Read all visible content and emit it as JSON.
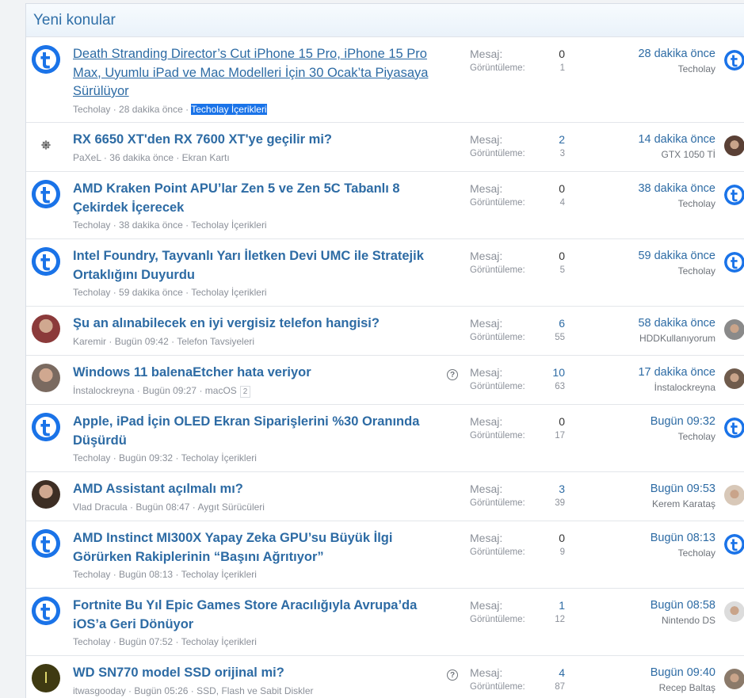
{
  "header": {
    "title": "Yeni konular"
  },
  "labels": {
    "messages": "Mesaj:",
    "views": "Görüntüleme:"
  },
  "threads": [
    {
      "title": "Death Stranding Director’s Cut iPhone 15 Pro, iPhone 15 Pro Max, Uyumlu iPad ve Mac Modelleri İçin 30 Ocak’ta Piyasaya Sürülüyor",
      "author": "Techolay",
      "time": "28 dakika önce",
      "forum": "Techolay İçerikleri",
      "replies": "0",
      "views": "1",
      "last_time": "28 dakika önce",
      "last_user": "Techolay",
      "avatar": "techolay-icon",
      "last_avatar": "techolay-icon"
    },
    {
      "title": "RX 6650 XT'den RX 7600 XT'ye geçilir mi?",
      "author": "PaXeL",
      "time": "36 dakika önce",
      "forum": "Ekran Kartı",
      "replies": "2",
      "views": "3",
      "last_time": "14 dakika önce",
      "last_user": "GTX 1050 Tİ",
      "avatar": "sinus-avatar",
      "last_avatar": "user-avatar"
    },
    {
      "title": "AMD Kraken Point APU’lar Zen 5 ve Zen 5C Tabanlı 8 Çekirdek İçerecek",
      "author": "Techolay",
      "time": "38 dakika önce",
      "forum": "Techolay İçerikleri",
      "replies": "0",
      "views": "4",
      "last_time": "38 dakika önce",
      "last_user": "Techolay",
      "avatar": "techolay-icon",
      "last_avatar": "techolay-icon"
    },
    {
      "title": "Intel Foundry, Tayvanlı Yarı İletken Devi UMC ile Stratejik Ortaklığını Duyurdu",
      "author": "Techolay",
      "time": "59 dakika önce",
      "forum": "Techolay İçerikleri",
      "replies": "0",
      "views": "5",
      "last_time": "59 dakika önce",
      "last_user": "Techolay",
      "avatar": "techolay-icon",
      "last_avatar": "techolay-icon"
    },
    {
      "title": "Şu an alınabilecek en iyi vergisiz telefon hangisi?",
      "author": "Karemir",
      "time": "Bugün 09:42",
      "forum": "Telefon Tavsiyeleri",
      "replies": "6",
      "views": "55",
      "last_time": "58 dakika önce",
      "last_user": "HDDKullanıyorum",
      "avatar": "user-avatar",
      "last_avatar": "user-avatar"
    },
    {
      "title": "Windows 11 balenaEtcher hata veriyor",
      "author": "İnstalockreyna",
      "time": "Bugün 09:27",
      "forum": "macOS",
      "pages": "2",
      "question": "?",
      "replies": "10",
      "views": "63",
      "last_time": "17 dakika önce",
      "last_user": "İnstalockreyna",
      "avatar": "user-avatar",
      "last_avatar": "user-avatar"
    },
    {
      "title": "Apple, iPad İçin OLED Ekran Siparişlerini %30 Oranında Düşürdü",
      "author": "Techolay",
      "time": "Bugün 09:32",
      "forum": "Techolay İçerikleri",
      "replies": "0",
      "views": "17",
      "last_time": "Bugün 09:32",
      "last_user": "Techolay",
      "avatar": "techolay-icon",
      "last_avatar": "techolay-icon"
    },
    {
      "title": "AMD Assistant açılmalı mı?",
      "author": "Vlad Dracula",
      "time": "Bugün 08:47",
      "forum": "Aygıt Sürücüleri",
      "replies": "3",
      "views": "39",
      "last_time": "Bugün 09:53",
      "last_user": "Kerem Karataş",
      "avatar": "user-avatar",
      "last_avatar": "user-avatar"
    },
    {
      "title": "AMD Instinct MI300X Yapay Zeka GPU’su Büyük İlgi Görürken Rakiplerinin “Başını Ağrıtıyor”",
      "author": "Techolay",
      "time": "Bugün 08:13",
      "forum": "Techolay İçerikleri",
      "replies": "0",
      "views": "9",
      "last_time": "Bugün 08:13",
      "last_user": "Techolay",
      "avatar": "techolay-icon",
      "last_avatar": "techolay-icon"
    },
    {
      "title": "Fortnite Bu Yıl Epic Games Store Aracılığıyla Avrupa’da iOS’a Geri Dönüyor",
      "author": "Techolay",
      "time": "Bugün 07:52",
      "forum": "Techolay İçerikleri",
      "replies": "1",
      "views": "12",
      "last_time": "Bugün 08:58",
      "last_user": "Nintendo DS",
      "avatar": "techolay-icon",
      "last_avatar": "user-avatar"
    },
    {
      "title": "WD SN770 model SSD orijinal mi?",
      "author": "itwasgooday",
      "time": "Bugün 05:26",
      "forum": "SSD, Flash ve Sabit Diskler",
      "question": "?",
      "replies": "4",
      "views": "87",
      "last_time": "Bugün 09:40",
      "last_user": "Recep Baltaş",
      "avatar": "letter-avatar-I",
      "avatar_letter": "I",
      "last_avatar": "user-avatar"
    }
  ]
}
